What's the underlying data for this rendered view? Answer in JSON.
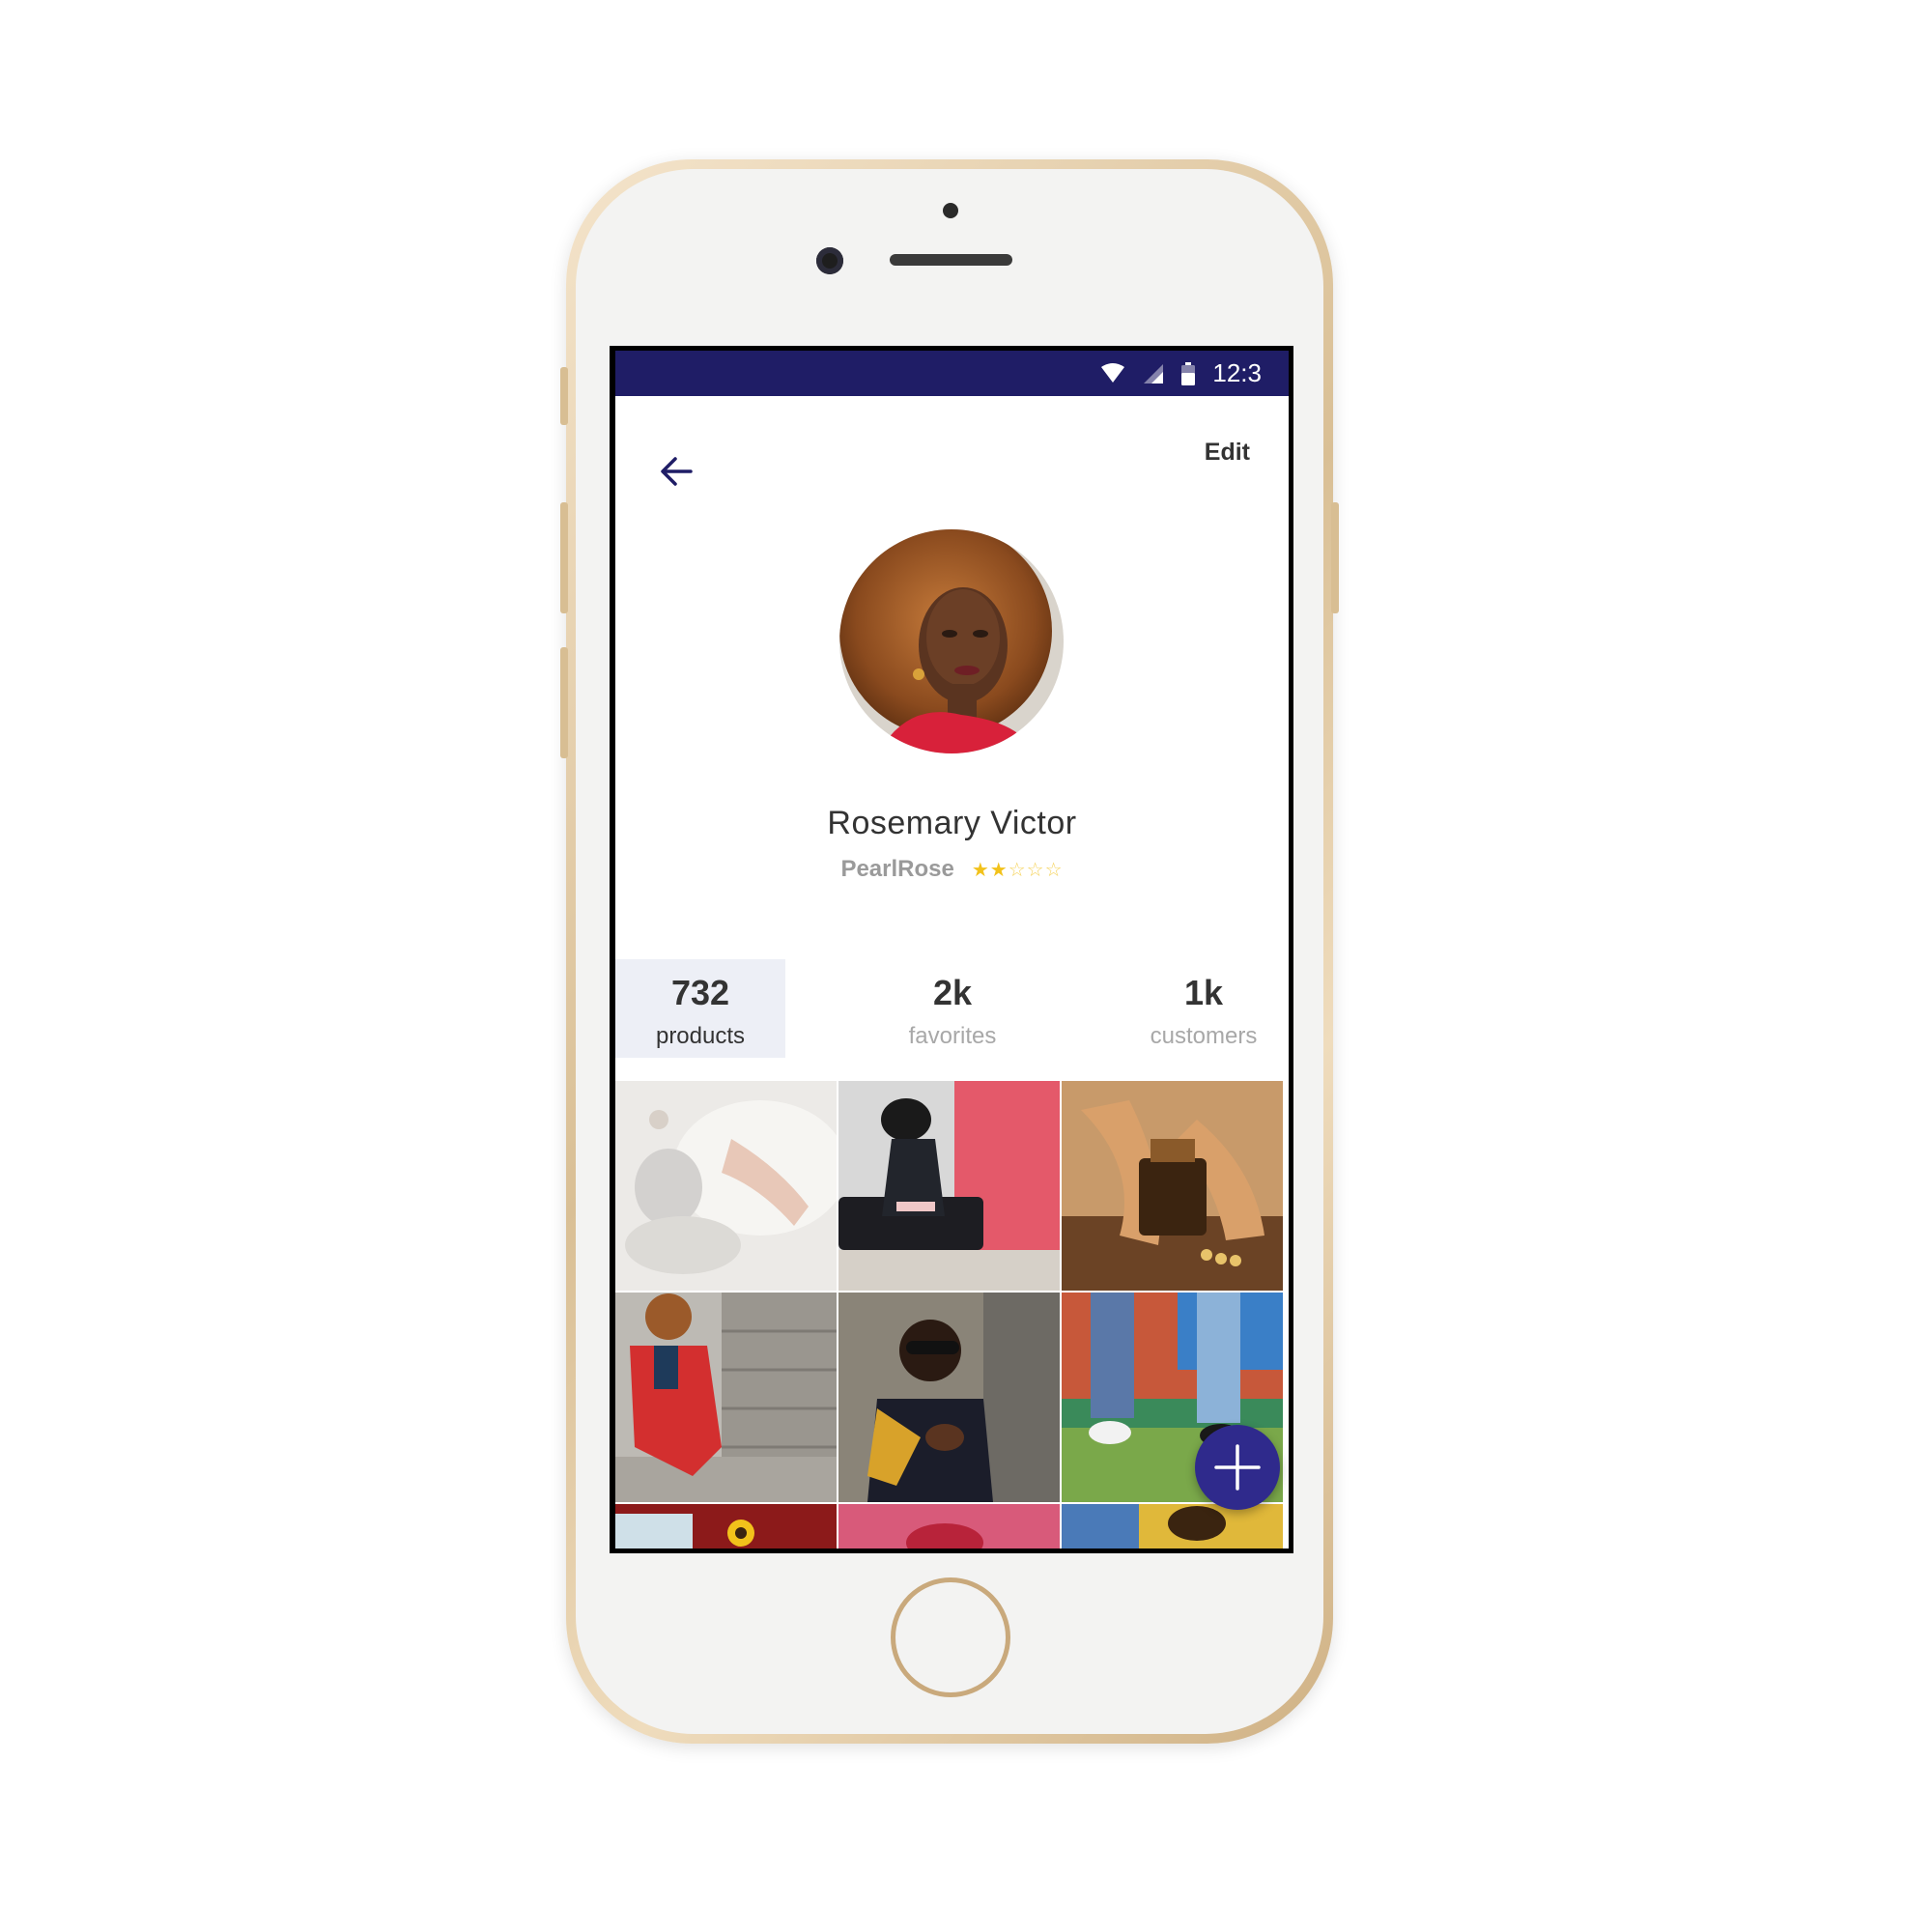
{
  "status_bar": {
    "time": "12:3",
    "icons": [
      "wifi-icon",
      "signal-icon",
      "battery-icon"
    ],
    "background": "#1f1d66"
  },
  "header": {
    "back_icon": "arrow-left-icon",
    "edit_label": "Edit"
  },
  "profile": {
    "name": "Rosemary Victor",
    "handle": "PearlRose",
    "rating": 2,
    "rating_max": 5
  },
  "stats": [
    {
      "value": "732",
      "label": "products",
      "active": true
    },
    {
      "value": "2k",
      "label": "favorites",
      "active": false
    },
    {
      "value": "1k",
      "label": "customers",
      "active": false
    }
  ],
  "fab": {
    "icon": "plus-icon",
    "color": "#2f2a8c"
  },
  "colors": {
    "accent": "#1f1d66",
    "star": "#f2c21b",
    "active_tab_bg": "#edeff6"
  }
}
